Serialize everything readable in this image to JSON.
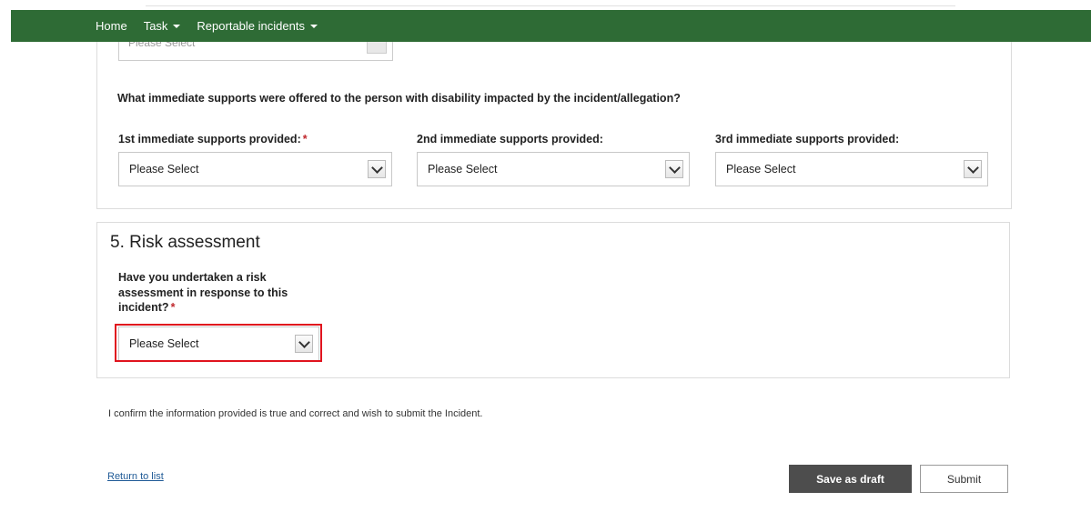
{
  "nav": {
    "items": [
      {
        "label": "Home"
      },
      {
        "label": "Task"
      },
      {
        "label": "Reportable incidents"
      }
    ]
  },
  "upper": {
    "partial_select": "Please Select",
    "question": "What immediate supports were offered to the person with disability impacted by the incident/allegation?",
    "fields": [
      {
        "label": "1st immediate supports provided:",
        "required": "*",
        "value": "Please Select"
      },
      {
        "label": "2nd immediate supports provided:",
        "value": "Please Select"
      },
      {
        "label": "3rd immediate supports provided:",
        "value": "Please Select"
      }
    ]
  },
  "risk": {
    "title": "5. Risk assessment",
    "question": "Have you undertaken a risk assessment in response to this incident?",
    "required": "*",
    "value": "Please Select"
  },
  "confirm_text": "I confirm the information provided is true and correct and wish to submit the Incident.",
  "return_link": "Return to list",
  "buttons": {
    "save_draft": "Save as draft",
    "submit": "Submit"
  },
  "colors": {
    "nav_bg": "#2e6b35",
    "required": "#c0282d",
    "highlight": "#e0141e",
    "draft_btn": "#4d4d4d"
  }
}
